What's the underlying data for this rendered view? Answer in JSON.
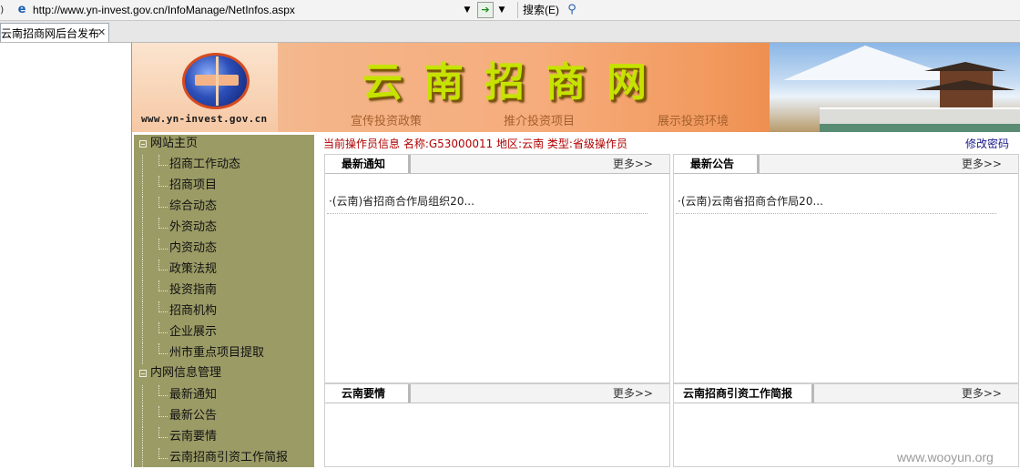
{
  "browser": {
    "url": "http://www.yn-invest.gov.cn/InfoManage/NetInfos.aspx",
    "search_label": "搜索(E)",
    "tab_title": "云南招商网后台发布",
    "icons": {
      "page": "ie-page-icon",
      "go": "go-arrow-icon",
      "search": "magnifier-icon",
      "close": "close-x-icon",
      "dropdown": "chevron-down-icon"
    }
  },
  "banner": {
    "site_url": "www.yn-invest.gov.cn",
    "site_title": "云南招商网",
    "subtitles": [
      "宣传投资政策",
      "推介投资项目",
      "展示投资环境"
    ]
  },
  "sidebar": {
    "groups": [
      {
        "label": "网站主页",
        "items": [
          "招商工作动态",
          "招商项目",
          "综合动态",
          "外资动态",
          "内资动态",
          "政策法规",
          "投资指南",
          "招商机构",
          "企业展示",
          "州市重点项目提取"
        ]
      },
      {
        "label": "内网信息管理",
        "items": [
          "最新通知",
          "最新公告",
          "云南要情",
          "云南招商引资工作简报"
        ]
      }
    ]
  },
  "main": {
    "operator_info": "当前操作员信息 名称:G53000011 地区:云南 类型:省级操作员",
    "change_password": "修改密码",
    "panels": [
      {
        "title": "最新通知",
        "more": "更多>>",
        "items": [
          "·(云南)省招商合作局组织20..."
        ]
      },
      {
        "title": "最新公告",
        "more": "更多>>",
        "items": [
          "·(云南)云南省招商合作局20..."
        ]
      },
      {
        "title": "云南要情",
        "more": "更多>>",
        "items": []
      },
      {
        "title": "云南招商引资工作简报",
        "more": "更多>>",
        "items": []
      }
    ]
  },
  "watermark": "www.wooyun.org",
  "colors": {
    "sidebar_bg": "#9b9b66",
    "operator_text": "#b00000",
    "banner_orange": "#f29a5f",
    "title_green": "#c6e300"
  }
}
